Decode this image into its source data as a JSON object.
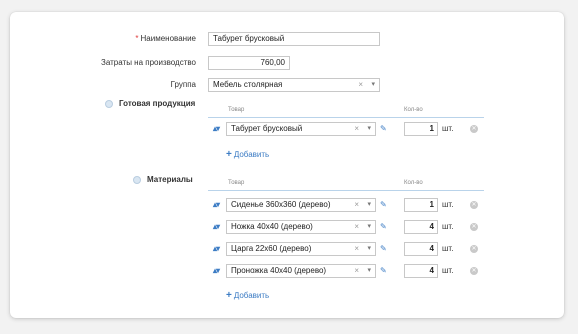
{
  "form": {
    "name_label": "Наименование",
    "name_required_mark": "*",
    "name_value": "Табурет брусковый",
    "cost_label": "Затраты на производство",
    "cost_value": "760,00",
    "group_label": "Группа",
    "group_value": "Мебель столярная"
  },
  "finished": {
    "title": "Готовая продукция",
    "col_product": "Товар",
    "col_qty": "Кол-во",
    "rows": [
      {
        "product": "Табурет брусковый",
        "qty": "1",
        "unit": "шт."
      }
    ],
    "add_label": "Добавить"
  },
  "materials": {
    "title": "Материалы",
    "col_product": "Товар",
    "col_qty": "Кол-во",
    "rows": [
      {
        "product": "Сиденье 360х360 (дерево)",
        "qty": "1",
        "unit": "шт."
      },
      {
        "product": "Ножка 40х40 (дерево)",
        "qty": "4",
        "unit": "шт."
      },
      {
        "product": "Царга 22х60 (дерево)",
        "qty": "4",
        "unit": "шт."
      },
      {
        "product": "Проножка 40х40 (дерево)",
        "qty": "4",
        "unit": "шт."
      }
    ],
    "add_label": "Добавить"
  },
  "icons": {
    "clear": "×",
    "dropdown": "▾",
    "move": "▴▾",
    "edit": "✎",
    "delete": "✕",
    "add": "+"
  }
}
